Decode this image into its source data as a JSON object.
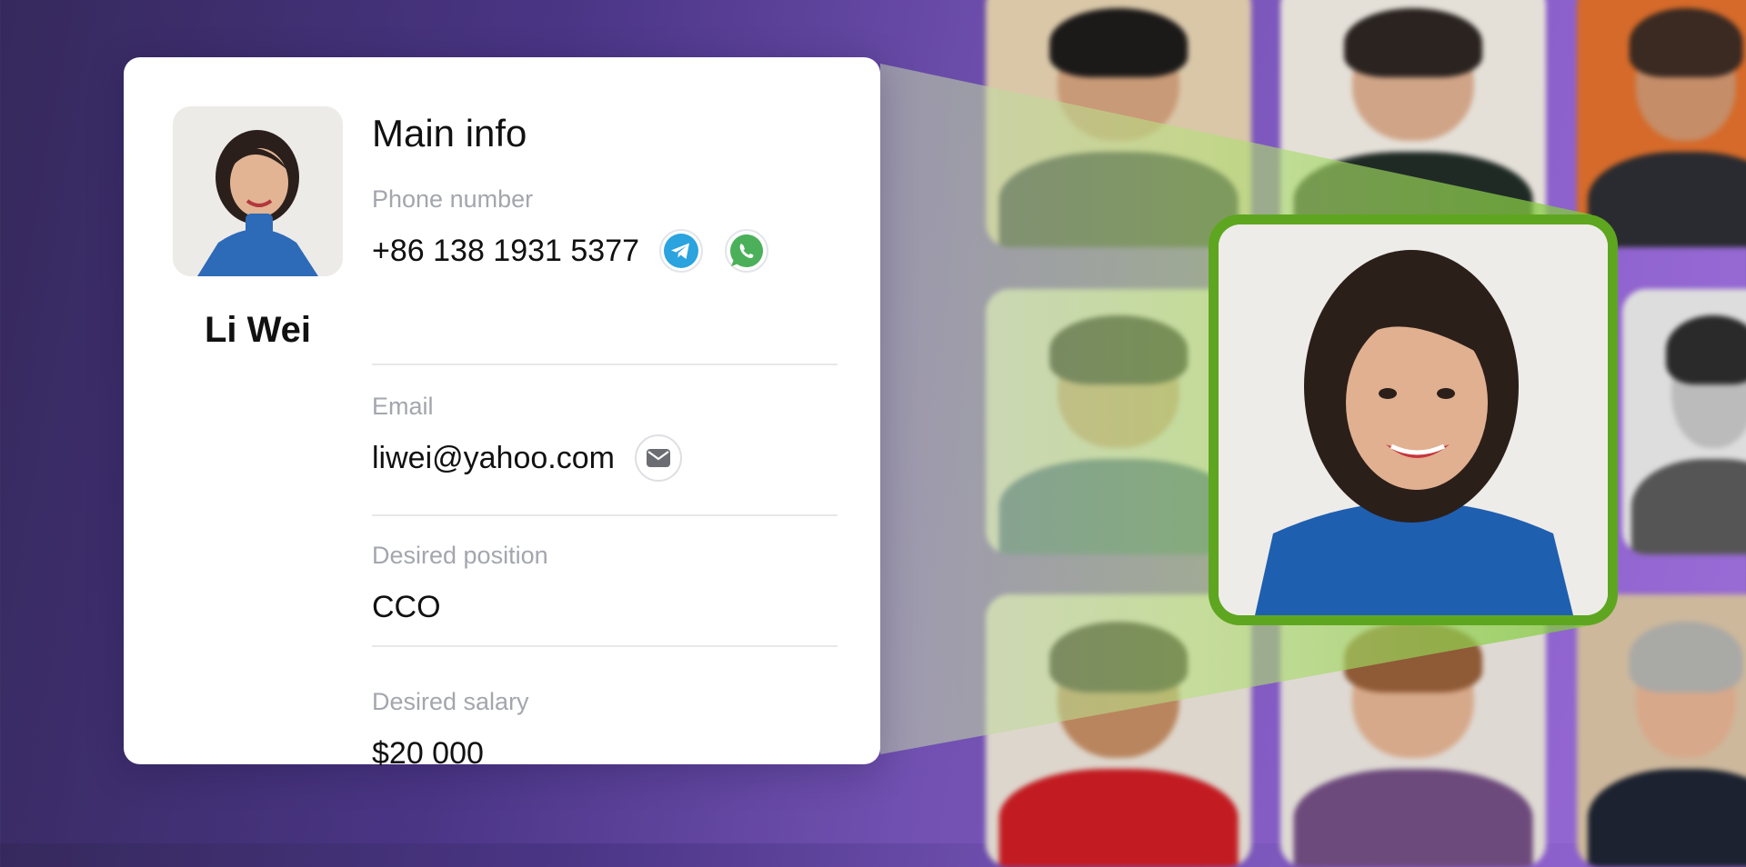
{
  "profile": {
    "name": "Li Wei",
    "avatar_icon": "profile-photo"
  },
  "main_info": {
    "title": "Main info",
    "phone": {
      "label": "Phone number",
      "value": "+86 138 1931 5377",
      "icons": [
        "telegram-icon",
        "whatsapp-icon"
      ]
    },
    "email": {
      "label": "Email",
      "value": "liwei@yahoo.com",
      "icons": [
        "mail-icon"
      ]
    },
    "position": {
      "label": "Desired position",
      "value": "CCO"
    },
    "salary": {
      "label": "Desired salary",
      "value": "$20 000"
    }
  },
  "colors": {
    "accent_green": "#5ea620",
    "telegram_blue": "#2aa3df",
    "whatsapp_green": "#4cb05b",
    "background_start": "#35295c",
    "background_end": "#9a6cd6"
  }
}
